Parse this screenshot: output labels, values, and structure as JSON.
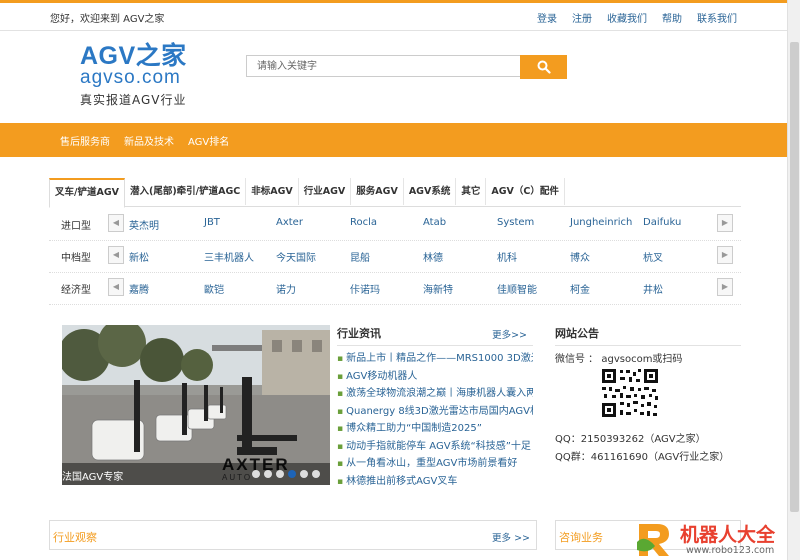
{
  "header": {
    "welcome": "您好，欢迎来到 AGV之家",
    "links": [
      "登录",
      "注册",
      "收藏我们",
      "帮助",
      "联系我们"
    ]
  },
  "logo": {
    "line1": "AGV之家",
    "line2": "agvso.com",
    "tagline": "真实报道AGV行业"
  },
  "search": {
    "placeholder": "请输入关键字",
    "icon": "search-icon"
  },
  "nav": {
    "items": [
      "售后服务商",
      "新品及技术",
      "AGV排名"
    ]
  },
  "category_tabs": [
    "叉车/铲道AGV",
    "潜入(尾部)牵引/铲道AGC",
    "非标AGV",
    "行业AGV",
    "服务AGV",
    "AGV系统",
    "其它",
    "AGV（C）配件"
  ],
  "brand_rows": [
    {
      "label": "进口型",
      "brands": [
        "英杰明",
        "JBT",
        "Axter",
        "Rocla",
        "Atab",
        "System",
        "Jungheinrich",
        "Daifuku"
      ]
    },
    {
      "label": "中档型",
      "brands": [
        "新松",
        "三丰机器人",
        "今天国际",
        "昆船",
        "林德",
        "机科",
        "博众",
        "杭叉"
      ]
    },
    {
      "label": "经济型",
      "brands": [
        "嘉腾",
        "歐铠",
        "诺力",
        "佧诺玛",
        "海新特",
        "佳顺智能",
        "柯金",
        "井松"
      ]
    }
  ],
  "slider": {
    "caption": "法国AGV专家",
    "banner_text": "AXTER",
    "banner_sub": "AUTO",
    "dots": 6,
    "active_dot": 3
  },
  "news": {
    "title": "行业资讯",
    "more": "更多>>",
    "items": [
      "新品上市丨精品之作——MRS1000 3D激光",
      "AGV移动机器人",
      "激荡全球物流浪潮之巅丨海康机器人囊入两项",
      "Quanergy 8线3D激光雷达市局国内AGV机器",
      "博众精工助力“中国制造2025”",
      "动动手指就能停车 AGV系统“科技感”十足",
      "从一角看冰山，重型AGV市场前景看好",
      "林德推出前移式AGV叉车"
    ]
  },
  "notice": {
    "title": "网站公告",
    "wechat": "微信号 ： agvsocom或扫码",
    "qq": "QQ：2150393262（AGV之家）",
    "qq_group": "QQ群：461161690（AGV行业之家）"
  },
  "bottom": {
    "left_title": "行业观察",
    "left_more": "更多 >>",
    "right_title": "咨询业务"
  },
  "watermark": {
    "title": "机器人大全",
    "url": "www.robo123.com"
  },
  "colors": {
    "accent": "#f39c1f",
    "link": "#2a6496",
    "logo_blue": "#2b78c4",
    "watermark_red": "#e8402f"
  }
}
